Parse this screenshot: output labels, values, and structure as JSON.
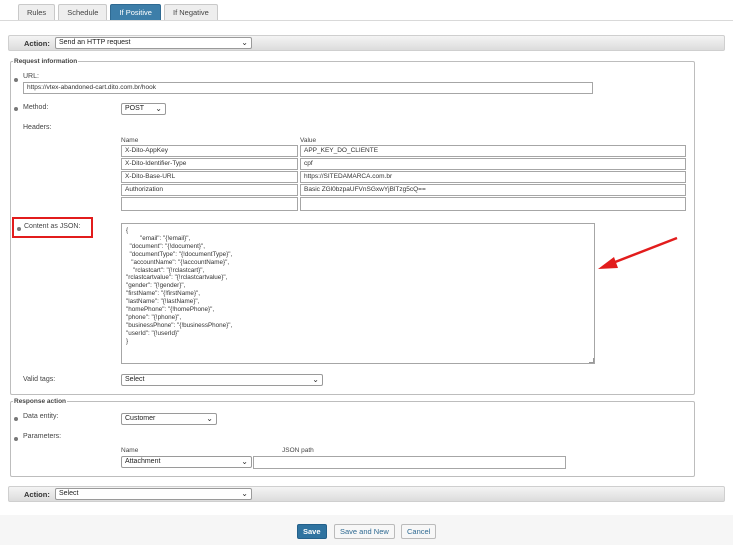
{
  "tabs": [
    {
      "label": "Rules",
      "active": false
    },
    {
      "label": "Schedule",
      "active": false
    },
    {
      "label": "If Positive",
      "active": true
    },
    {
      "label": "If Negative",
      "active": false
    }
  ],
  "action_top": {
    "label": "Action:",
    "value": "Send an HTTP request"
  },
  "request": {
    "legend": "Request information",
    "url_label": "URL:",
    "url_value": "https://vtex-abandoned-cart.dito.com.br/hook",
    "method_label": "Method:",
    "method_value": "POST",
    "headers_label": "Headers:",
    "headers_col_name": "Name",
    "headers_col_value": "Value",
    "headers_rows": [
      {
        "name": "X-Dito-AppKey",
        "value": "APP_KEY_DO_CLIENTE"
      },
      {
        "name": "X-Dito-Identifier-Type",
        "value": "cpf"
      },
      {
        "name": "X-Dito-Base-URL",
        "value": "https://SITEDAMARCA.com.br"
      },
      {
        "name": "Authorization",
        "value": "Basic ZGl0bzpaUFVnSGxwYjBlTzg5cQ=="
      },
      {
        "name": "",
        "value": ""
      }
    ],
    "content_label": "Content as JSON:",
    "content_value": "{\n        \"email\": \"{!email}\",\n  \"document\": \"{!document}\",\n  \"documentType\": \"{!documentType}\",\n   \"accountName\": \"{!accountName}\",\n    \"rclastcart\": \"{!rclastcart}\",\n\"rclastcartvalue\": \"{!rclastcartvalue}\",\n\"gender\": \"{!gender}\",\n\"firstName\": \"{!firstName}\",\n\"lastName\": \"{!lastName}\",\n\"homePhone\": \"{!homePhone}\",\n\"phone\": \"{!phone}\",\n\"businessPhone\": \"{!businessPhone}\",\n\"userId\": \"{!userId}\"\n}",
    "valid_tags_label": "Valid tags:",
    "valid_tags_value": "Select"
  },
  "response": {
    "legend": "Response action",
    "entity_label": "Data entity:",
    "entity_value": "Customer",
    "params_label": "Parameters:",
    "params_col_name": "Name",
    "params_col_path": "JSON path",
    "param_name_value": "Attachment",
    "param_path_value": ""
  },
  "action_bottom": {
    "label": "Action:",
    "value": "Select"
  },
  "buttons": {
    "save": "Save",
    "save_new": "Save and New",
    "cancel": "Cancel"
  },
  "colors": {
    "accent": "#2f73a0",
    "highlight": "#e21c1c"
  }
}
